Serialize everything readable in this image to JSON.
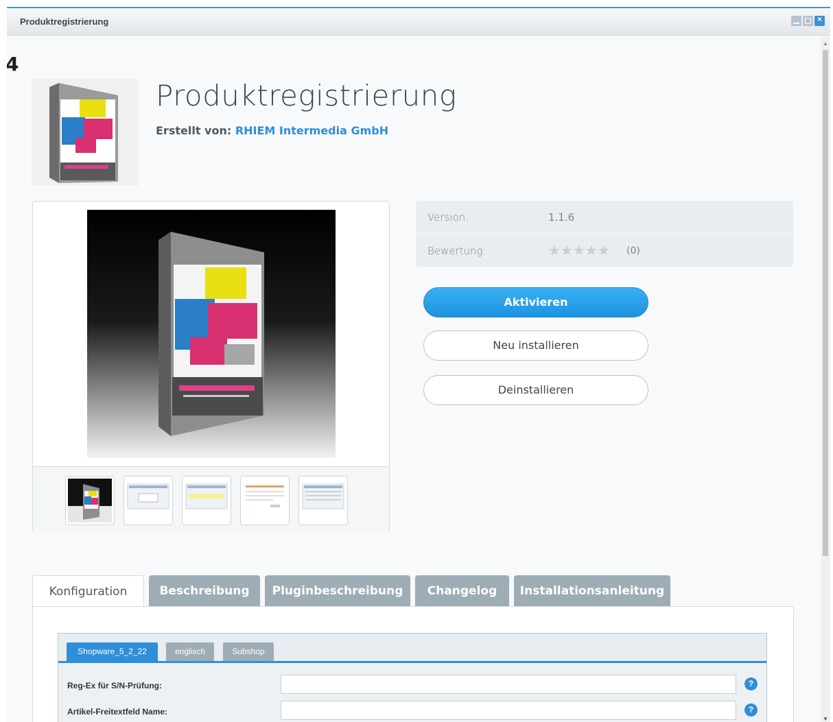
{
  "window": {
    "title": "Produktregistrierung",
    "controls": [
      "minimize-icon",
      "maximize-icon",
      "close-icon"
    ]
  },
  "step_number": "4",
  "plugin": {
    "name": "Produktregistrierung",
    "author_label": "Erstellt von:",
    "author_name": "RHIEM Intermedia GmbH"
  },
  "info": {
    "version_label": "Version:",
    "version_value": "1.1.6",
    "rating_label": "Bewertung:",
    "rating_stars": "★★★★★",
    "rating_count": "(0)"
  },
  "actions": {
    "activate": "Aktivieren",
    "reinstall": "Neu installieren",
    "uninstall": "Deinstallieren"
  },
  "tabs": [
    {
      "label": "Konfiguration",
      "active": true
    },
    {
      "label": "Beschreibung"
    },
    {
      "label": "Pluginbeschreibung"
    },
    {
      "label": "Changelog"
    },
    {
      "label": "Installationsanleitung"
    }
  ],
  "config": {
    "shop_tabs": [
      {
        "label": "Shopware_5_2_22",
        "active": true
      },
      {
        "label": "englisch"
      },
      {
        "label": "Subshop"
      }
    ],
    "fields": [
      {
        "label": "Reg-Ex für S/N-Prüfung:",
        "value": ""
      },
      {
        "label": "Artikel-Freitextfeld Name:",
        "value": ""
      }
    ],
    "help_glyph": "?"
  },
  "colors": {
    "accent": "#2f8ed8",
    "tab_inactive": "#9eacb5"
  }
}
